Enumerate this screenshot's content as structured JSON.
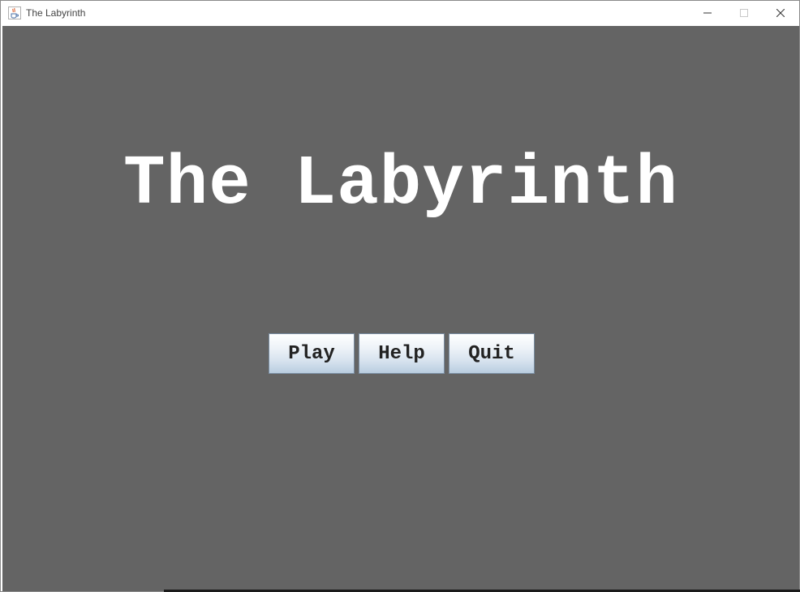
{
  "window": {
    "title": "The Labyrinth",
    "app_icon": "java-coffee-cup-icon",
    "controls": [
      "minimize-icon",
      "maximize-icon",
      "close-icon"
    ]
  },
  "game": {
    "title": "The Labyrinth",
    "buttons": {
      "play": "Play",
      "help": "Help",
      "quit": "Quit"
    }
  },
  "colors": {
    "background": "#646464",
    "title_text": "#ffffff",
    "button_text": "#222222"
  }
}
